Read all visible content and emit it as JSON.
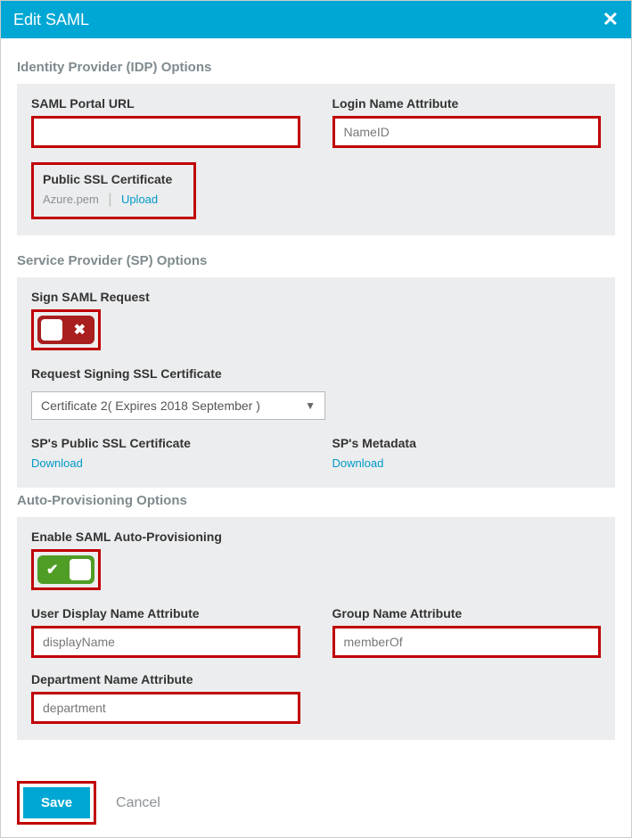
{
  "titlebar": {
    "title": "Edit SAML"
  },
  "idp": {
    "section": "Identity Provider (IDP) Options",
    "portal_label": "SAML Portal URL",
    "portal_value": "",
    "login_label": "Login Name Attribute",
    "login_value": "NameID",
    "ssl_label": "Public SSL Certificate",
    "ssl_file": "Azure.pem",
    "upload": "Upload"
  },
  "sp": {
    "section": "Service Provider (SP) Options",
    "sign_label": "Sign SAML Request",
    "req_cert_label": "Request Signing SSL Certificate",
    "req_cert_value": "Certificate 2( Expires 2018 September )",
    "pub_cert_label": "SP's Public SSL Certificate",
    "meta_label": "SP's Metadata",
    "download": "Download"
  },
  "ap": {
    "section": "Auto-Provisioning Options",
    "enable_label": "Enable SAML Auto-Provisioning",
    "udn_label": "User Display Name Attribute",
    "udn_value": "displayName",
    "grp_label": "Group Name Attribute",
    "grp_value": "memberOf",
    "dep_label": "Department Name Attribute",
    "dep_value": "department"
  },
  "footer": {
    "save": "Save",
    "cancel": "Cancel"
  }
}
